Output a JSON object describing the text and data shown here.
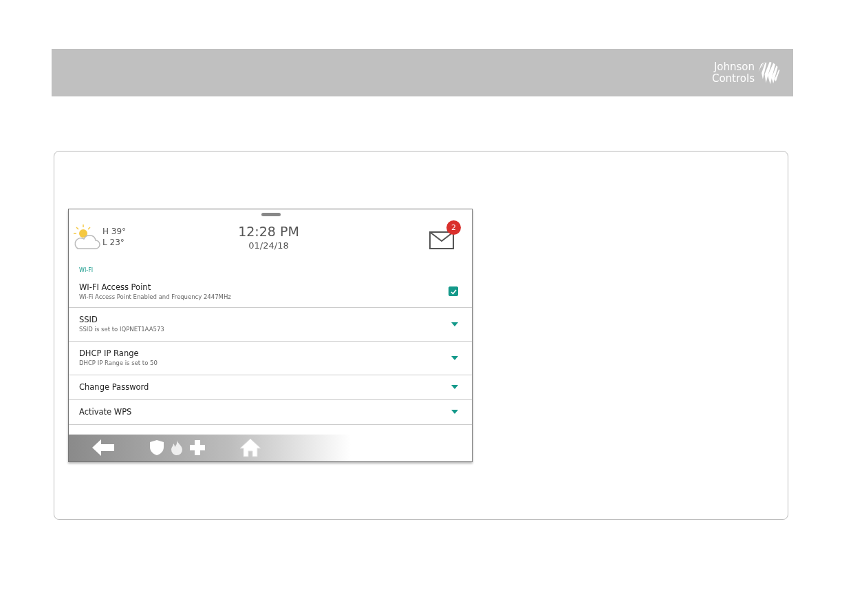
{
  "header": {
    "logo": [
      "Johnson",
      "Controls"
    ]
  },
  "panel": {
    "weather": {
      "high": "H 39°",
      "low": "L 23°"
    },
    "time": "12:28 PM",
    "date": "01/24/18",
    "messages": {
      "count": "2"
    },
    "section": "WI-FI",
    "settings": [
      {
        "kind": "checkbox",
        "title": "WI-FI Access Point",
        "subtitle": "Wi-Fi Access Point Enabled and Frequency 2447MHz",
        "checked": true
      },
      {
        "kind": "dropdown",
        "title": "SSID",
        "subtitle": "SSID is set to IQPNET1AA573"
      },
      {
        "kind": "dropdown",
        "title": "DHCP IP Range",
        "subtitle": "DHCP IP Range is set to 50"
      },
      {
        "kind": "dropdown",
        "title": "Change Password"
      },
      {
        "kind": "dropdown",
        "title": "Activate WPS"
      },
      {
        "kind": "hidden"
      }
    ]
  }
}
